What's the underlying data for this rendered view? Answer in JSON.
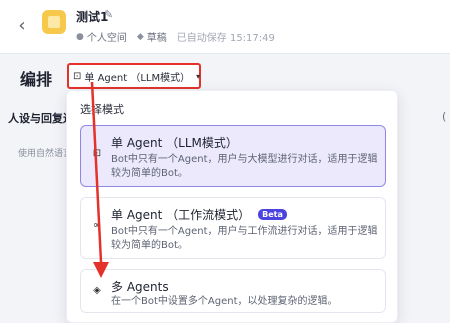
{
  "header": {
    "back_glyph": "‹",
    "bot_name": "测试1",
    "edit_glyph": "✎",
    "space": "个人空间",
    "status": "草稿",
    "saved": "已自动保存 15:17:49"
  },
  "main": {
    "section_title": "编排",
    "mode_select": {
      "icon": "⊡",
      "value": "单 Agent （LLM模式）",
      "caret": "▾"
    },
    "left_panel": {
      "title": "人设与回复逻",
      "hint": "使用自然语言",
      "right_edge": "("
    }
  },
  "dropdown": {
    "header": "选择模式",
    "options": [
      {
        "icon": "⊡",
        "title": "单 Agent （LLM模式）",
        "desc": "Bot中只有一个Agent，用户与大模型进行对话，适用于逻辑较为简单的Bot。",
        "selected": true
      },
      {
        "icon": "∞",
        "title": "单 Agent （工作流模式）",
        "badge": "Beta",
        "desc": "Bot中只有一个Agent，用户与工作流进行对话，适用于逻辑较为简单的Bot。",
        "selected": false
      },
      {
        "icon": "◈",
        "title": "多 Agents",
        "desc": "在一个Bot中设置多个Agent，以处理复杂的逻辑。",
        "selected": false
      }
    ]
  },
  "colors": {
    "highlight_red": "#e4322b",
    "selected_bg": "#ebe9fb",
    "selected_border": "#8f87e6",
    "beta_badge": "#4a43e0",
    "bot_icon": "#f6c84c"
  }
}
